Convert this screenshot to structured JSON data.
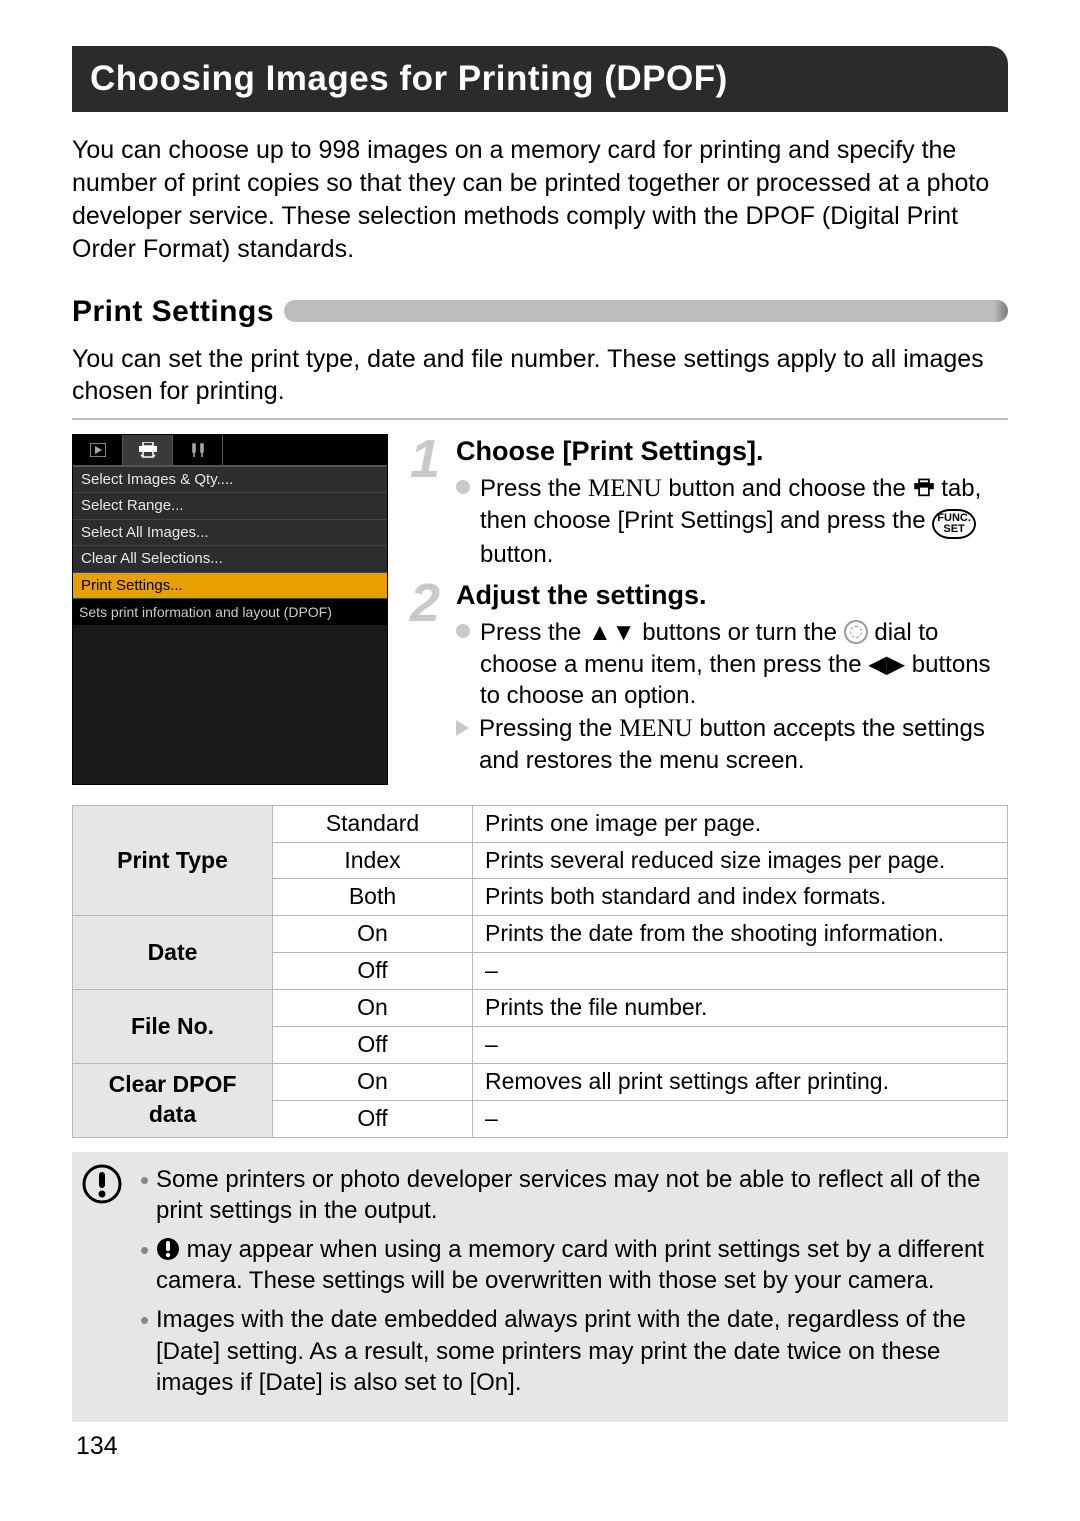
{
  "title": "Choosing Images for Printing (DPOF)",
  "intro": "You can choose up to 998 images on a memory card for printing and specify the number of print copies so that they can be printed together or processed at a photo developer service. These selection methods comply with the DPOF (Digital Print Order Format) standards.",
  "subhead": "Print Settings",
  "sub_intro": "You can set the print type, date and file number. These settings apply to all images chosen for printing.",
  "menu": {
    "items": [
      "Select Images & Qty....",
      "Select Range...",
      "Select All Images...",
      "Clear All Selections...",
      "Print Settings..."
    ],
    "footer": "Sets print information and layout (DPOF)"
  },
  "steps": [
    {
      "num": "1",
      "title": "Choose [Print Settings].",
      "b1a": "Press the ",
      "b1b": " button and choose the ",
      "b1c": " tab, then choose [Print Settings] and press the ",
      "b1d": " button."
    },
    {
      "num": "2",
      "title": "Adjust the settings.",
      "b1a": "Press the ",
      "b1b": " buttons or turn the ",
      "b1c": " dial to choose a menu item, then press the ",
      "b1d": " buttons to choose an option.",
      "b2a": "Pressing the ",
      "b2b": " button accepts the settings and restores the menu screen."
    }
  ],
  "menu_label": "MENU",
  "func_label_top": "FUNC.",
  "func_label_bot": "SET",
  "table": {
    "rows": [
      {
        "head": "Print Type",
        "opts": [
          {
            "o": "Standard",
            "d": "Prints one image per page."
          },
          {
            "o": "Index",
            "d": "Prints several reduced size images per page."
          },
          {
            "o": "Both",
            "d": "Prints both standard and index formats."
          }
        ]
      },
      {
        "head": "Date",
        "opts": [
          {
            "o": "On",
            "d": "Prints the date from the shooting information."
          },
          {
            "o": "Off",
            "d": "–"
          }
        ]
      },
      {
        "head": "File No.",
        "opts": [
          {
            "o": "On",
            "d": "Prints the file number."
          },
          {
            "o": "Off",
            "d": "–"
          }
        ]
      },
      {
        "head": "Clear DPOF data",
        "opts": [
          {
            "o": "On",
            "d": "Removes all print settings after printing."
          },
          {
            "o": "Off",
            "d": "–"
          }
        ]
      }
    ]
  },
  "caution": {
    "n1": "Some printers or photo developer services may not be able to reflect all of the print settings in the output.",
    "n2b": " may appear when using a memory card with print settings set by a different camera. These settings will be overwritten with those set by your camera.",
    "n3": "Images with the date embedded always print with the date, regardless of the [Date] setting. As a result, some printers may print the date twice on these images if [Date] is also set to [On]."
  },
  "page": "134"
}
